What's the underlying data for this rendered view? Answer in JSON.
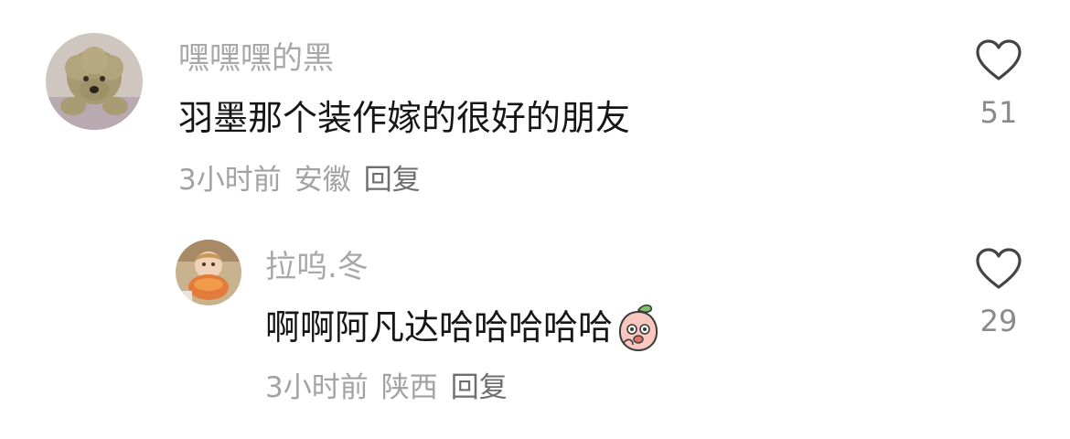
{
  "comments": [
    {
      "username": "嘿嘿嘿的黑",
      "content": "羽墨那个装作嫁的很好的朋友",
      "time": "3小时前",
      "location": "安徽",
      "reply_label": "回复",
      "like_count": "51",
      "avatar_icon": "poodle-dog-avatar"
    },
    {
      "username": "拉呜.冬",
      "content": "啊啊阿凡达哈哈哈哈哈",
      "emoji_icon": "peach-face-emoji",
      "time": "3小时前",
      "location": "陕西",
      "reply_label": "回复",
      "like_count": "29",
      "avatar_icon": "child-eating-avatar"
    }
  ],
  "colors": {
    "username": "#a8a8a8",
    "content": "#161616",
    "meta": "#a2a2a2",
    "like_icon": "#444444"
  }
}
